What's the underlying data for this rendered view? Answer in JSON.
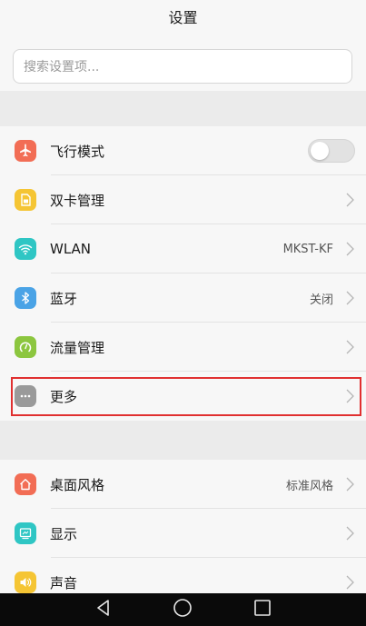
{
  "header": {
    "title": "设置"
  },
  "search": {
    "placeholder": "搜索设置项..."
  },
  "group1": {
    "items": [
      {
        "label": "飞行模式",
        "icon": "airplane-icon",
        "color": "#f26d55",
        "toggle": false
      },
      {
        "label": "双卡管理",
        "icon": "sim-card-icon",
        "color": "#f5c534"
      },
      {
        "label": "WLAN",
        "value": "MKST-KF",
        "icon": "wifi-icon",
        "color": "#2fc6c4"
      },
      {
        "label": "蓝牙",
        "value": "关闭",
        "icon": "bluetooth-icon",
        "color": "#4aa3e6"
      },
      {
        "label": "流量管理",
        "icon": "data-usage-icon",
        "color": "#8cc63f"
      },
      {
        "label": "更多",
        "icon": "more-icon",
        "color": "#9a9a9a"
      }
    ]
  },
  "group2": {
    "items": [
      {
        "label": "桌面风格",
        "value": "标准风格",
        "icon": "home-icon",
        "color": "#f26d55"
      },
      {
        "label": "显示",
        "icon": "display-icon",
        "color": "#2fc6c4"
      },
      {
        "label": "声音",
        "icon": "sound-icon",
        "color": "#f5c534"
      }
    ]
  },
  "highlight_color": "#e03030"
}
